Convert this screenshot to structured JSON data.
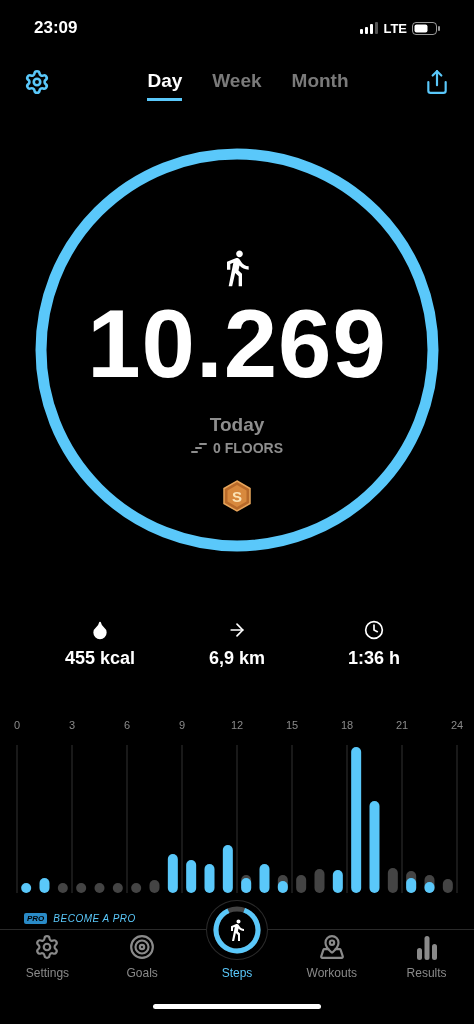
{
  "status_bar": {
    "time": "23:09",
    "network": "LTE"
  },
  "tabs": [
    {
      "label": "Day",
      "selected": true
    },
    {
      "label": "Week",
      "selected": false
    },
    {
      "label": "Month",
      "selected": false
    }
  ],
  "summary": {
    "level": 1,
    "steps": "10.269",
    "period": "Today",
    "floors": "0 FLOORS",
    "badge": "S"
  },
  "stats": [
    {
      "kind": "calories",
      "value": "455 kcal"
    },
    {
      "kind": "distance",
      "value": "6,9 km"
    },
    {
      "kind": "duration",
      "value": "1:36 h"
    }
  ],
  "hourly_chart": {
    "hour_labels": [
      "0",
      "3",
      "6",
      "9",
      "12",
      "15",
      "18",
      "21",
      "24"
    ]
  },
  "promo": {
    "badge": "PRO",
    "text": "BECOME A PRO"
  },
  "tab_bar": [
    {
      "kind": "settings",
      "label": "Settings",
      "selected": false
    },
    {
      "kind": "goals",
      "label": "Goals",
      "selected": false
    },
    {
      "kind": "steps",
      "label": "Steps",
      "selected": true
    },
    {
      "kind": "workouts",
      "label": "Workouts",
      "selected": false
    },
    {
      "kind": "results",
      "label": "Results",
      "selected": false
    }
  ]
}
